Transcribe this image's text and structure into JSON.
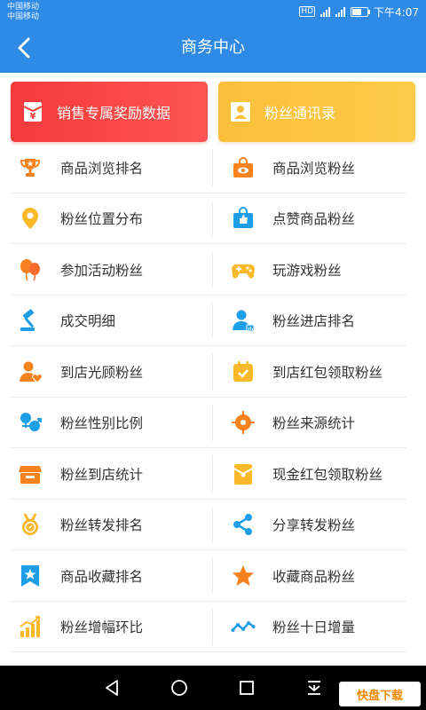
{
  "status": {
    "carrier1": "中国移动",
    "carrier2": "中国移动",
    "hd": "HD",
    "time": "下午4:07"
  },
  "header": {
    "title": "商务中心"
  },
  "cards": [
    {
      "label": "销售专属奖励数据",
      "icon": "red-envelope-icon",
      "color": "#f53a3a"
    },
    {
      "label": "粉丝通讯录",
      "icon": "contact-card-icon",
      "color": "#fbbf3a"
    }
  ],
  "menu": [
    {
      "left": {
        "label": "商品浏览排名",
        "icon": "trophy-icon"
      },
      "right": {
        "label": "商品浏览粉丝",
        "icon": "bag-eye-icon"
      }
    },
    {
      "left": {
        "label": "粉丝位置分布",
        "icon": "location-pin-icon"
      },
      "right": {
        "label": "点赞商品粉丝",
        "icon": "bag-thumb-icon"
      }
    },
    {
      "left": {
        "label": "参加活动粉丝",
        "icon": "balloons-icon"
      },
      "right": {
        "label": "玩游戏粉丝",
        "icon": "gamepad-icon"
      }
    },
    {
      "left": {
        "label": "成交明细",
        "icon": "gavel-icon"
      },
      "right": {
        "label": "粉丝进店排名",
        "icon": "user-rank-icon"
      }
    },
    {
      "left": {
        "label": "到店光顾粉丝",
        "icon": "user-heart-icon"
      },
      "right": {
        "label": "到店红包领取粉丝",
        "icon": "calendar-check-icon"
      }
    },
    {
      "left": {
        "label": "粉丝性别比例",
        "icon": "gender-icon"
      },
      "right": {
        "label": "粉丝来源统计",
        "icon": "target-icon"
      }
    },
    {
      "left": {
        "label": "粉丝到店统计",
        "icon": "store-icon"
      },
      "right": {
        "label": "现金红包领取粉丝",
        "icon": "envelope-icon"
      }
    },
    {
      "left": {
        "label": "粉丝转发排名",
        "icon": "medal-icon"
      },
      "right": {
        "label": "分享转发粉丝",
        "icon": "share-icon"
      }
    },
    {
      "left": {
        "label": "商品收藏排名",
        "icon": "bookmark-star-icon"
      },
      "right": {
        "label": "收藏商品粉丝",
        "icon": "star-icon"
      }
    },
    {
      "left": {
        "label": "粉丝增幅环比",
        "icon": "bar-growth-icon"
      },
      "right": {
        "label": "粉丝十日增量",
        "icon": "line-trend-icon"
      }
    }
  ],
  "watermark": {
    "brand": "快盘下载"
  },
  "colors": {
    "primary": "#2f8ae6",
    "orange": "#f5821f",
    "yellow": "#fbb829",
    "blue": "#1f9ee8"
  }
}
